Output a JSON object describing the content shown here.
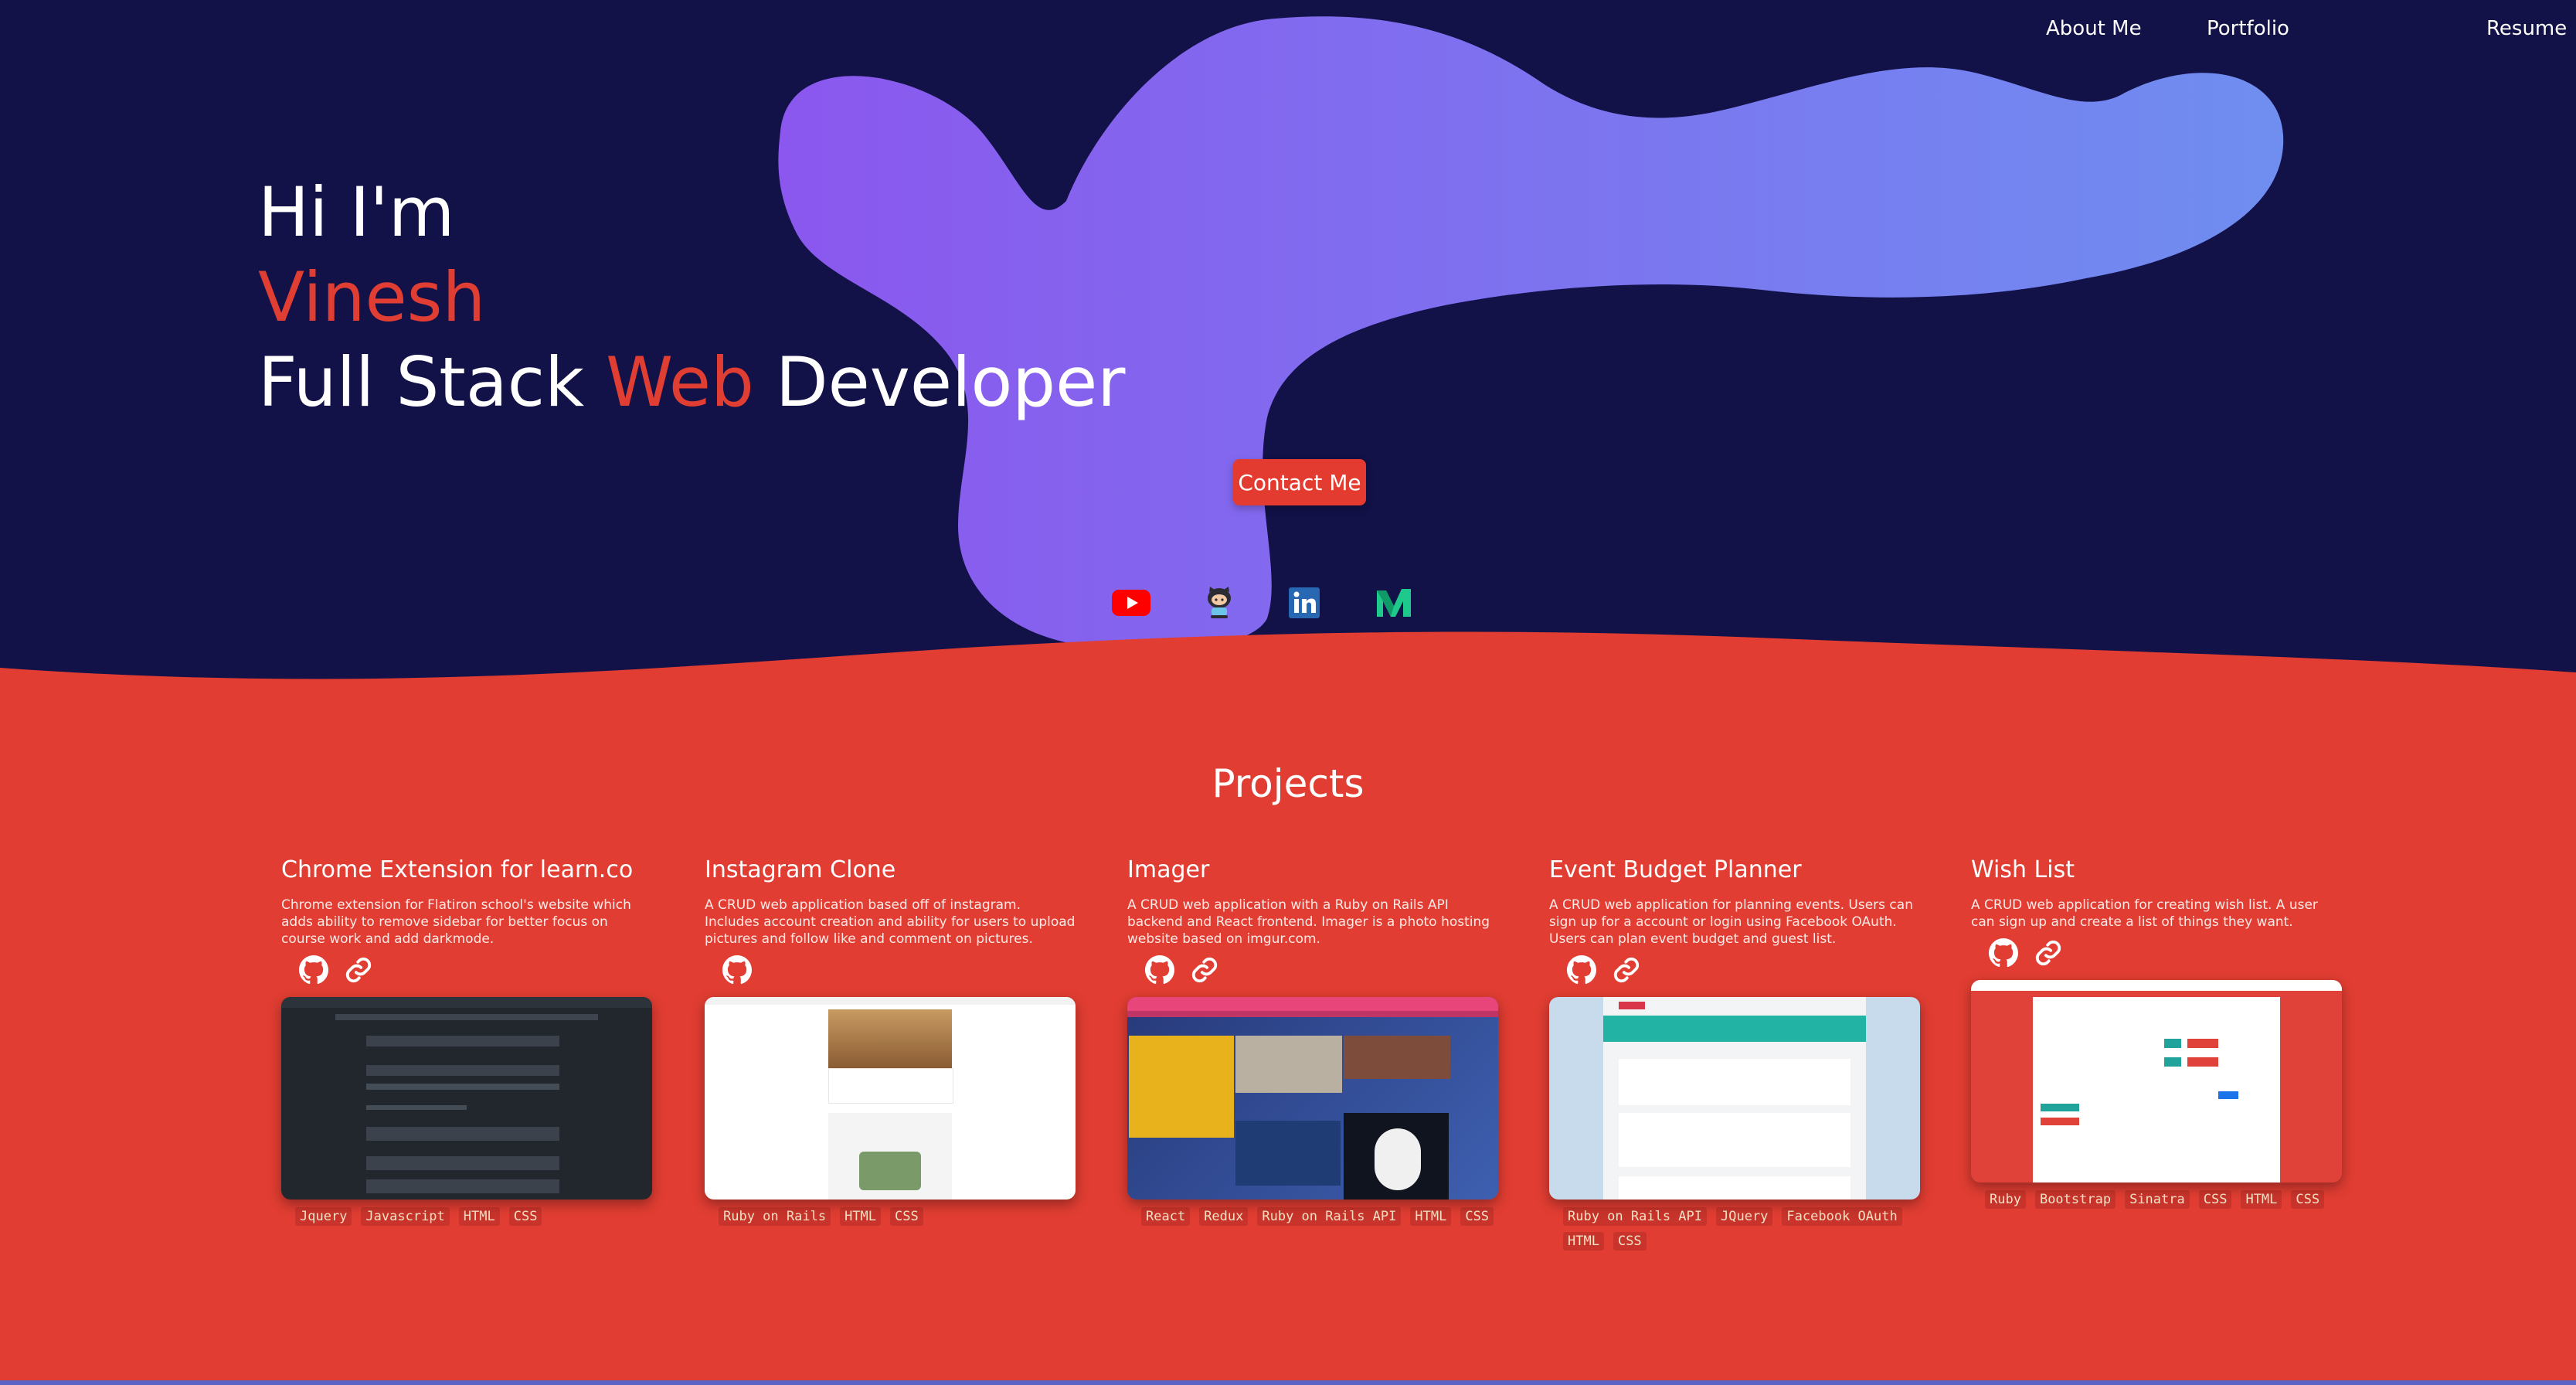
{
  "nav": {
    "items": [
      {
        "label": "About Me"
      },
      {
        "label": "Portfolio"
      },
      {
        "label": "Resume"
      }
    ]
  },
  "hero": {
    "greeting": "Hi I'm",
    "name": "Vinesh",
    "role_part1": "Full Stack ",
    "role_accent": "Web",
    "role_part2": " Developer",
    "contact_label": "Contact Me"
  },
  "social": [
    "youtube-icon",
    "github-octocat-icon",
    "linkedin-icon",
    "medium-icon"
  ],
  "colors": {
    "navy": "#121148",
    "red": "#e03e33",
    "blob_start": "#8a57ee",
    "blob_end": "#6e8cf0"
  },
  "projects_title": "Projects",
  "projects": [
    {
      "title": "Chrome Extension for learn.co",
      "description": "Chrome extension for Flatiron school's website which adds ability to remove sidebar for better focus on course work and add darkmode.",
      "tags": [
        "Jquery",
        "Javascript",
        "HTML",
        "CSS"
      ]
    },
    {
      "title": "Instagram Clone",
      "description": "A CRUD web application based off of instagram. Includes account creation and ability for users to upload pictures and follow like and comment on pictures.",
      "tags": [
        "Ruby on Rails",
        "HTML",
        "CSS"
      ]
    },
    {
      "title": "Imager",
      "description": "A CRUD web application with a Ruby on Rails API backend and React frontend. Imager is a photo hosting website based on imgur.com.",
      "tags": [
        "React",
        "Redux",
        "Ruby on Rails API",
        "HTML",
        "CSS"
      ]
    },
    {
      "title": "Event Budget Planner",
      "description": "A CRUD web application for planning events. Users can sign up for a account or login using Facebook OAuth. Users can plan event budget and guest list.",
      "tags": [
        "Ruby on Rails API",
        "JQuery",
        "Facebook OAuth",
        "HTML",
        "CSS"
      ]
    },
    {
      "title": "Wish List",
      "description": "A CRUD web application for creating wish list. A user can sign up and create a list of things they want.",
      "tags": [
        "Ruby",
        "Bootstrap",
        "Sinatra",
        "CSS",
        "HTML",
        "CSS"
      ]
    }
  ]
}
